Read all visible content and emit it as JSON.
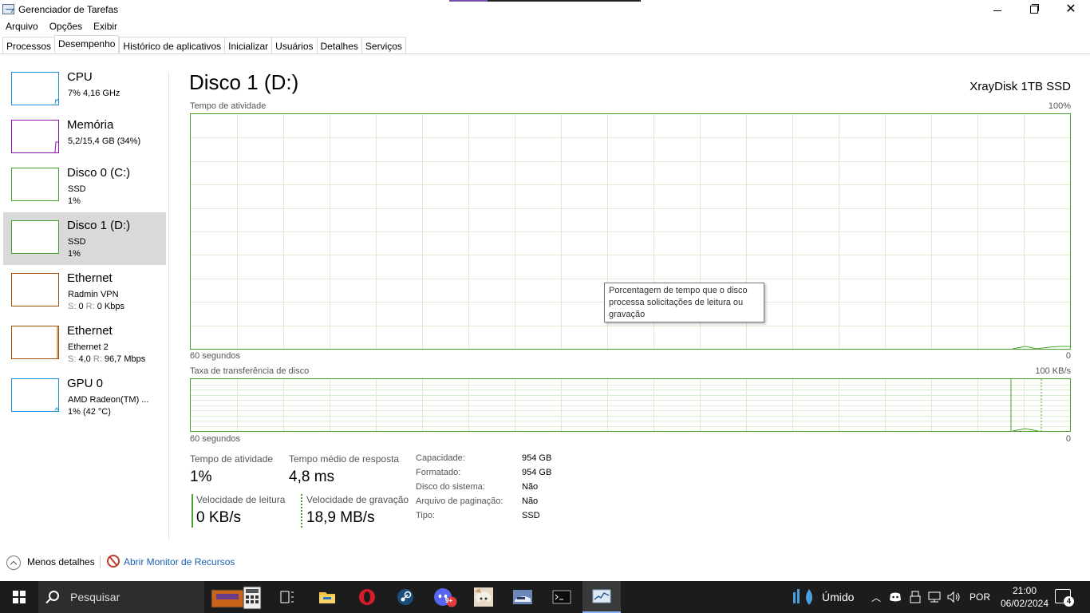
{
  "window": {
    "title": "Gerenciador de Tarefas",
    "minimize": "–",
    "maximize": "❐",
    "close": "✕"
  },
  "menu": [
    "Arquivo",
    "Opções",
    "Exibir"
  ],
  "tabs": [
    "Processos",
    "Desempenho",
    "Histórico de aplicativos",
    "Inicializar",
    "Usuários",
    "Detalhes",
    "Serviços"
  ],
  "active_tab": "Desempenho",
  "sidebar": [
    {
      "name": "CPU",
      "line1": "7% 4,16 GHz",
      "line2": "",
      "color": "#1a8fd6"
    },
    {
      "name": "Memória",
      "line1": "5,2/15,4 GB (34%)",
      "line2": "",
      "color": "#8b12ae"
    },
    {
      "name": "Disco 0 (C:)",
      "line1": "SSD",
      "line2": "1%",
      "color": "#4aa02c"
    },
    {
      "name": "Disco 1 (D:)",
      "line1": "SSD",
      "line2": "1%",
      "color": "#4aa02c"
    },
    {
      "name": "Ethernet",
      "line1": "Radmin VPN",
      "line2_s": "S:",
      "line2_sv": "0",
      "line2_r": "R:",
      "line2_rv": "0 Kbps",
      "color": "#a74f01"
    },
    {
      "name": "Ethernet",
      "line1": "Ethernet 2",
      "line2_s": "S:",
      "line2_sv": "4,0",
      "line2_r": "R:",
      "line2_rv": "96,7 Mbps",
      "color": "#a74f01"
    },
    {
      "name": "GPU 0",
      "line1": "AMD Radeon(TM) ...",
      "line2": "1% (42 °C)",
      "color": "#1a8fd6"
    }
  ],
  "main": {
    "title": "Disco 1 (D:)",
    "device": "XrayDisk 1TB SSD",
    "graph1": {
      "label": "Tempo de atividade",
      "max": "100%",
      "time": "60 segundos",
      "min": "0"
    },
    "graph2": {
      "label": "Taxa de transferência de disco",
      "max": "100 KB/s",
      "time": "60 segundos",
      "min": "0"
    },
    "tooltip": "Porcentagem de tempo que o disco processa solicitações de leitura ou gravação",
    "stats": {
      "active_time_label": "Tempo de atividade",
      "active_time_value": "1%",
      "response_label": "Tempo médio de resposta",
      "response_value": "4,8 ms",
      "read_label": "Velocidade de leitura",
      "read_value": "0 KB/s",
      "write_label": "Velocidade de gravação",
      "write_value": "18,9 MB/s"
    },
    "properties": [
      {
        "label": "Capacidade:",
        "value": "954 GB"
      },
      {
        "label": "Formatado:",
        "value": "954 GB"
      },
      {
        "label": "Disco do sistema:",
        "value": "Não"
      },
      {
        "label": "Arquivo de paginação:",
        "value": "Não"
      },
      {
        "label": "Tipo:",
        "value": "SSD"
      }
    ]
  },
  "bottom": {
    "less_details": "Menos detalhes",
    "resource_monitor": "Abrir Monitor de Recursos"
  },
  "taskbar": {
    "search_placeholder": "Pesquisar",
    "weather": "Úmido",
    "language": "POR",
    "time": "21:00",
    "date": "06/02/2024",
    "notifications": "4",
    "discord_badge": "9+"
  }
}
